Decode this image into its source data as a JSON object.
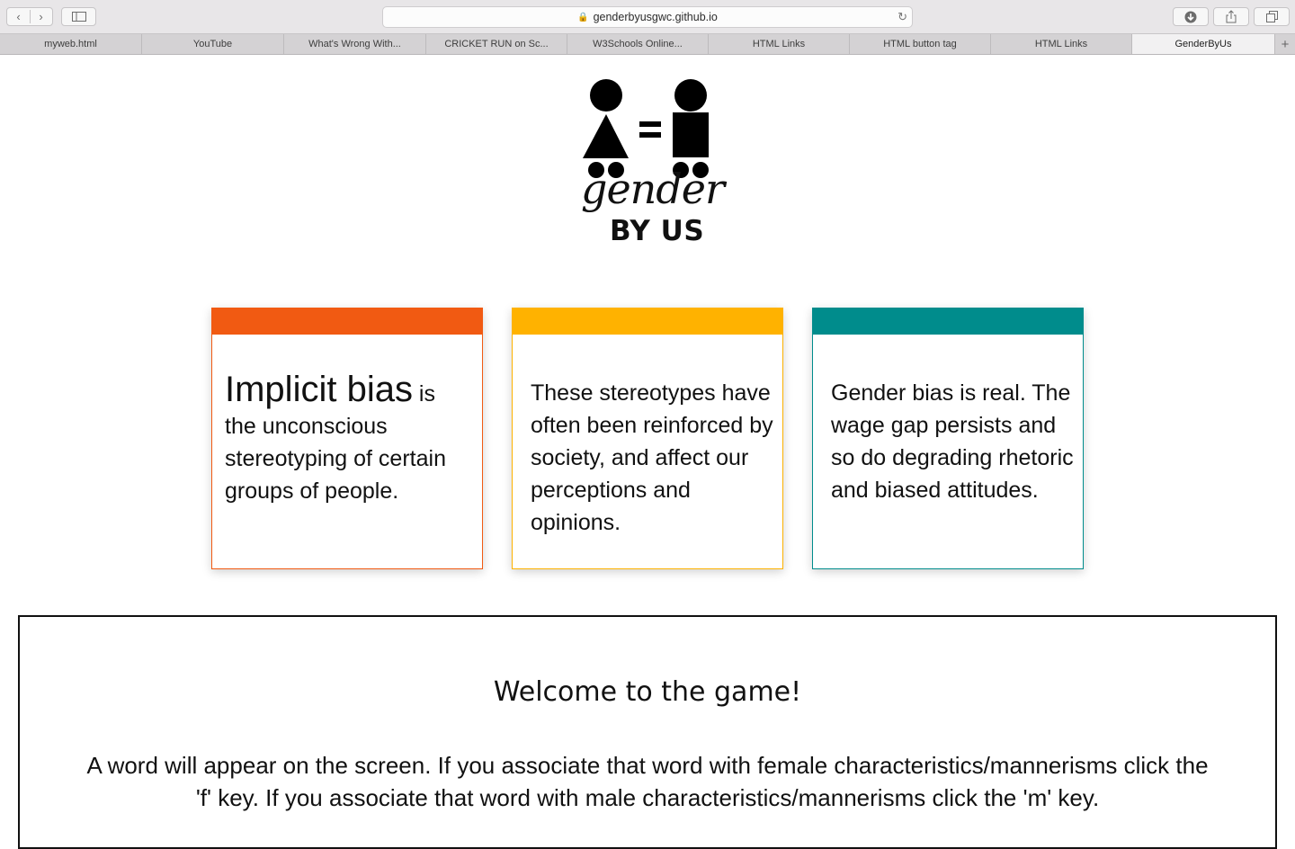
{
  "browser": {
    "url": "genderbyusgwc.github.io",
    "tabs": [
      {
        "label": "myweb.html"
      },
      {
        "label": "YouTube"
      },
      {
        "label": "What's Wrong With..."
      },
      {
        "label": "CRICKET RUN on Sc..."
      },
      {
        "label": "W3Schools Online..."
      },
      {
        "label": "HTML Links"
      },
      {
        "label": "HTML button tag"
      },
      {
        "label": "HTML Links"
      },
      {
        "label": "GenderByUs"
      }
    ],
    "active_tab_index": 8
  },
  "logo": {
    "script_text": "gender",
    "by_text": "BY US"
  },
  "cards": [
    {
      "lead": "Implicit bias",
      "rest_small": " is",
      "rest": " the unconscious stereotyping of certain groups of people.",
      "color": "#f15a12"
    },
    {
      "text": "These stereotypes have often been reinforced by society, and affect our perceptions and opinions.",
      "color": "#ffb200"
    },
    {
      "text": "Gender bias is real. The wage gap persists and so do degrading rhetoric and biased attitudes.",
      "color": "#008c8c"
    }
  ],
  "game": {
    "title": "Welcome to the game!",
    "instructions": "A word will appear on the screen. If you associate that word with female characteristics/mannerisms click the 'f' key. If you associate that word with male characteristics/mannerisms click the 'm' key."
  }
}
